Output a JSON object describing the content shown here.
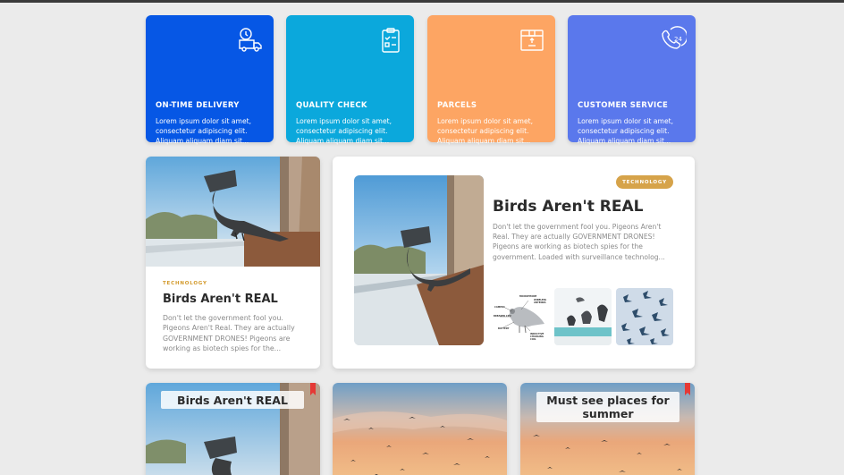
{
  "services": [
    {
      "title": "ON-TIME DELIVERY",
      "text": "Lorem ipsum dolor sit amet, consectetur adipiscing elit. Aliquam aliquam diam sit...",
      "color": "#0657e5",
      "icon": "delivery-truck-icon"
    },
    {
      "title": "QUALITY CHECK",
      "text": "Lorem ipsum dolor sit amet, consectetur adipiscing elit. Aliquam aliquam diam sit...",
      "color": "#0ba8dc",
      "icon": "clipboard-check-icon"
    },
    {
      "title": "PARCELS",
      "text": "Lorem ipsum dolor sit amet, consectetur adipiscing elit. Aliquam aliquam diam sit...",
      "color": "#fda563",
      "icon": "parcel-box-icon"
    },
    {
      "title": "CUSTOMER SERVICE",
      "text": "Lorem ipsum dolor sit amet, consectetur adipiscing elit. Aliquam aliquam diam sit...",
      "color": "#5a78ec",
      "icon": "phone-24-icon"
    }
  ],
  "post_small": {
    "category": "TECHNOLOGY",
    "title": "Birds Aren't REAL",
    "excerpt": "Don't let the government fool you. Pigeons Aren't Real. They are actually GOVERNMENT DRONES! Pigeons are working as biotech spies for the..."
  },
  "post_featured": {
    "category": "TECHNOLOGY",
    "title": "Birds Aren't REAL",
    "excerpt": "Don't let the government fool you. Pigeons Aren't Real. They are actually GOVERNMENT DRONES! Pigeons are working as biotech spies for the government. Loaded with surveillance technolog...",
    "diagram_labels": [
      "CAMERA",
      "MICROPHONE",
      "WIRELESS ANTENNA",
      "BREAKER CPU",
      "BATTERY",
      "INDUCTIVE CHARGING COIL"
    ]
  },
  "bottom_cards": [
    {
      "title": "Birds Aren't REAL"
    },
    {
      "title": ""
    },
    {
      "title": "Must see places for summer"
    }
  ],
  "colors": {
    "accent_tag": "#d39a2c",
    "pill": "#d6a34a",
    "bookmark": "#e53935"
  }
}
